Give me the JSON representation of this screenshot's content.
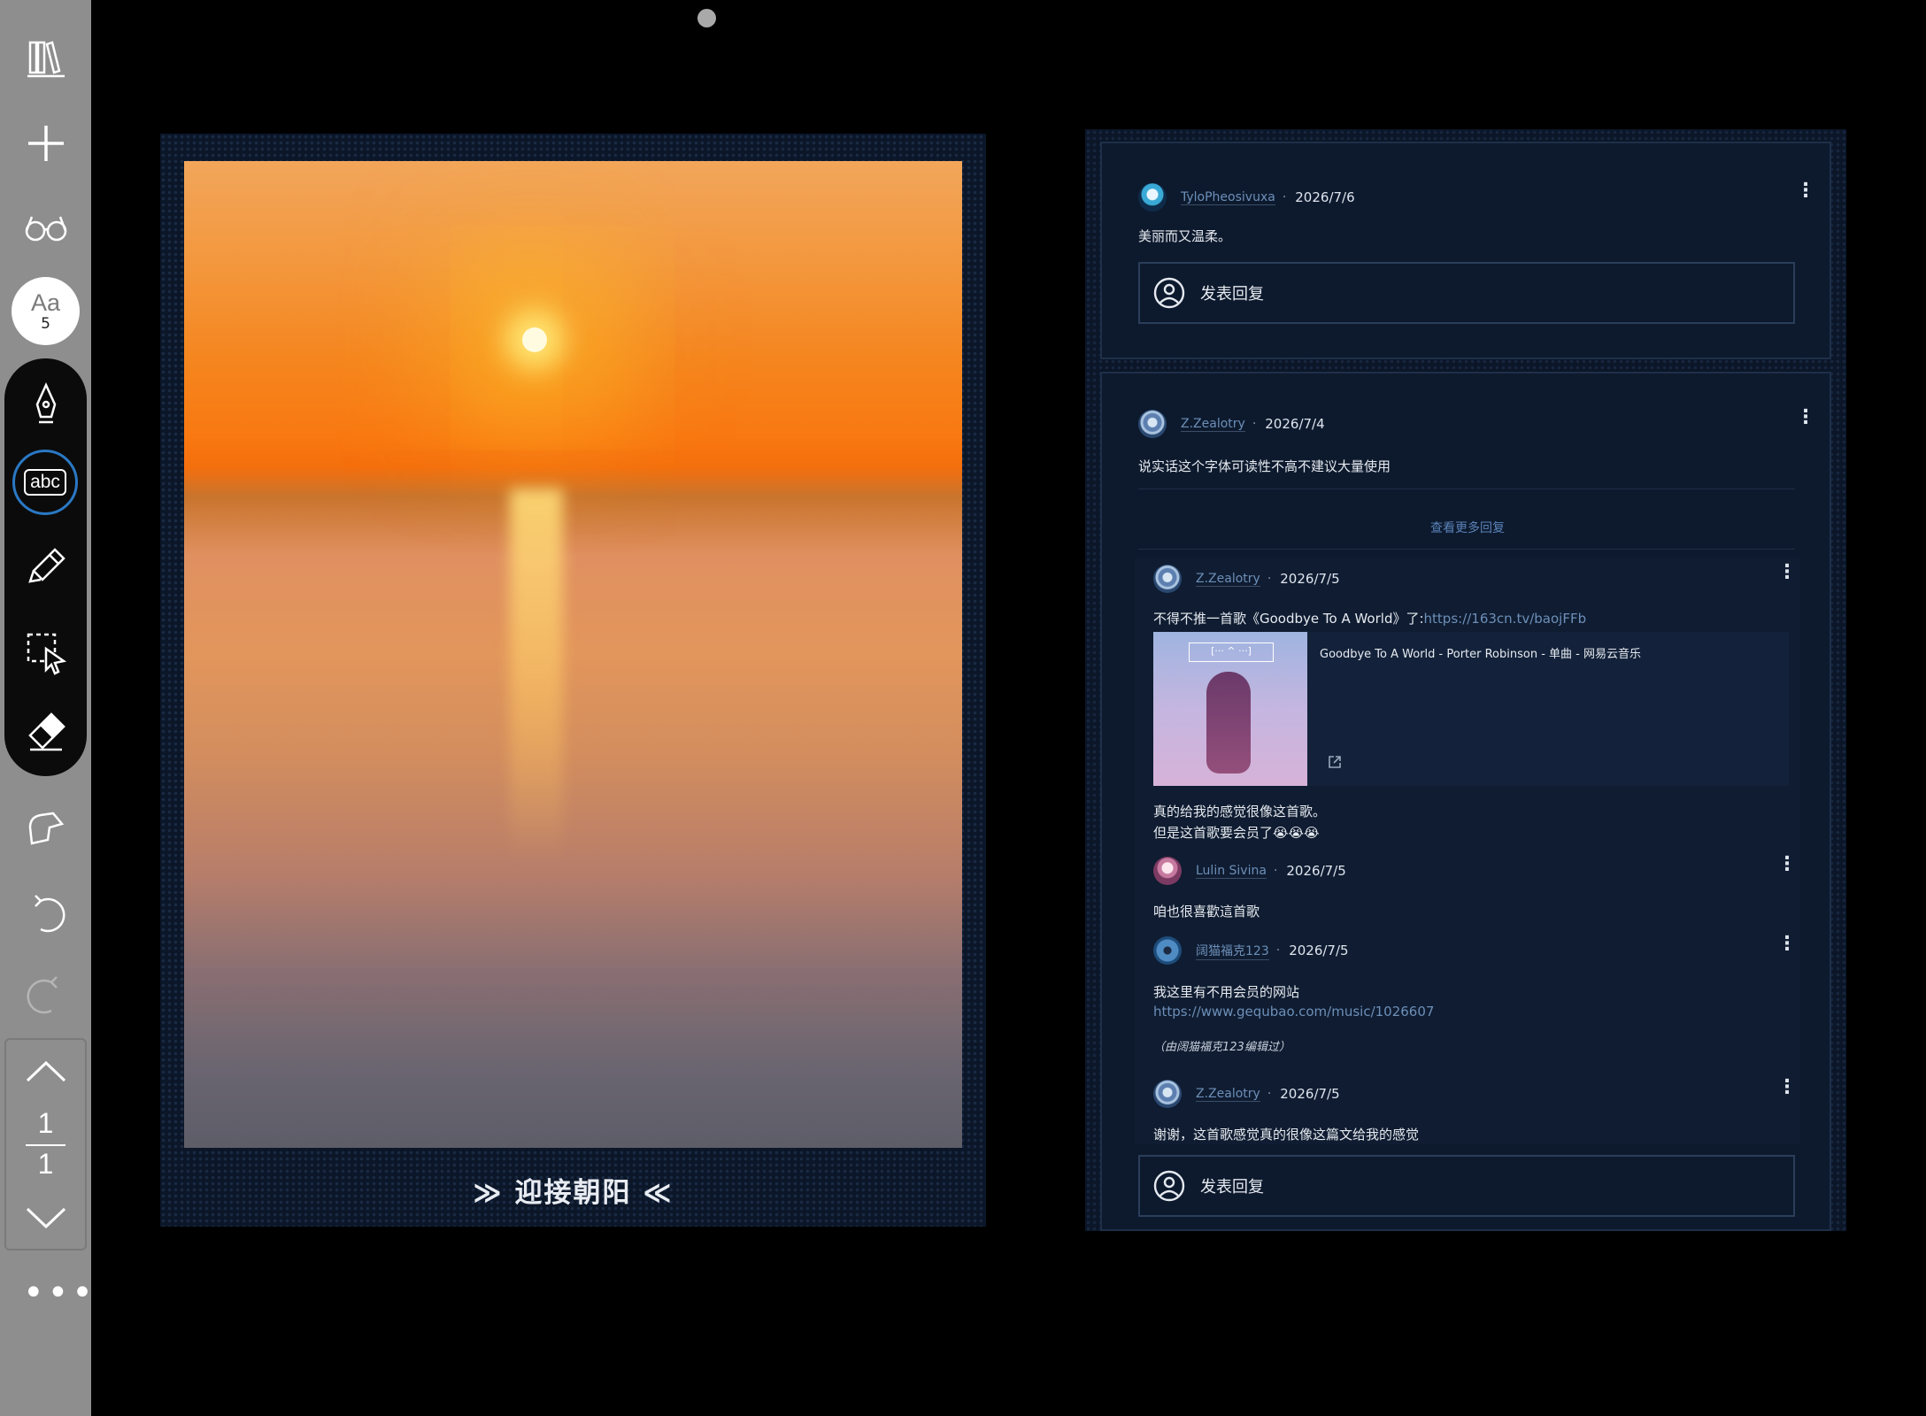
{
  "sidebar": {
    "tools": [
      {
        "name": "library-icon"
      },
      {
        "name": "add-icon"
      },
      {
        "name": "reading-glasses-icon"
      }
    ],
    "font_button": {
      "label": "Aa",
      "size": "5"
    },
    "pen_tools": [
      "pen-icon",
      "text-tool-icon",
      "highlighter-icon",
      "lasso-select-icon",
      "eraser-icon"
    ],
    "text_tool_label": "abc",
    "extra_tools": [
      "pointer-touch-icon",
      "undo-icon",
      "redo-icon"
    ],
    "page_nav": {
      "current": "1",
      "total": "1"
    },
    "more_label": "•••"
  },
  "left_page": {
    "caption": "≫ 迎接朝阳 ≪"
  },
  "right_page": {
    "card1": {
      "user": "TyloPheosivuxa",
      "sep": "·",
      "date": "2026/7/6",
      "text": "美丽而又温柔。",
      "reply_label": "发表回复"
    },
    "card2": {
      "main": {
        "user": "Z.Zealotry",
        "sep": "·",
        "date": "2026/7/4",
        "text": "说实话这个字体可读性不高不建议大量使用"
      },
      "more_replies": "查看更多回复",
      "replies": [
        {
          "user": "Z.Zealotry",
          "sep": "·",
          "date": "2026/7/5",
          "text_prefix": "不得不推一首歌《Goodbye To A World》了:",
          "link": "https://163cn.tv/baojFFb",
          "music_title": "Goodbye To A World - Porter Robinson - 单曲 - 网易云音乐",
          "album_label": "[··· ^ ···]",
          "line2": "真的给我的感觉很像这首歌。",
          "line3": "但是这首歌要会员了😭😭😭"
        },
        {
          "user": "Lulin Sivina",
          "sep": "·",
          "date": "2026/7/5",
          "text": "咱也很喜歡這首歌"
        },
        {
          "user": "阔猫福克123",
          "sep": "·",
          "date": "2026/7/5",
          "text": "我这里有不用会员的网站",
          "link": "https://www.gequbao.com/music/1026607",
          "edit_note": "（由阔猫福克123编辑过）"
        },
        {
          "user": "Z.Zealotry",
          "sep": "·",
          "date": "2026/7/5",
          "text": "谢谢，这首歌感觉真的很像这篇文给我的感觉"
        }
      ],
      "reply_label": "发表回复"
    }
  },
  "colors": {
    "sidebar_bg": "#8e8e8e",
    "accent": "#2a78c4",
    "panel_bg": "#0d1a2e",
    "link": "#6d8fb8"
  }
}
